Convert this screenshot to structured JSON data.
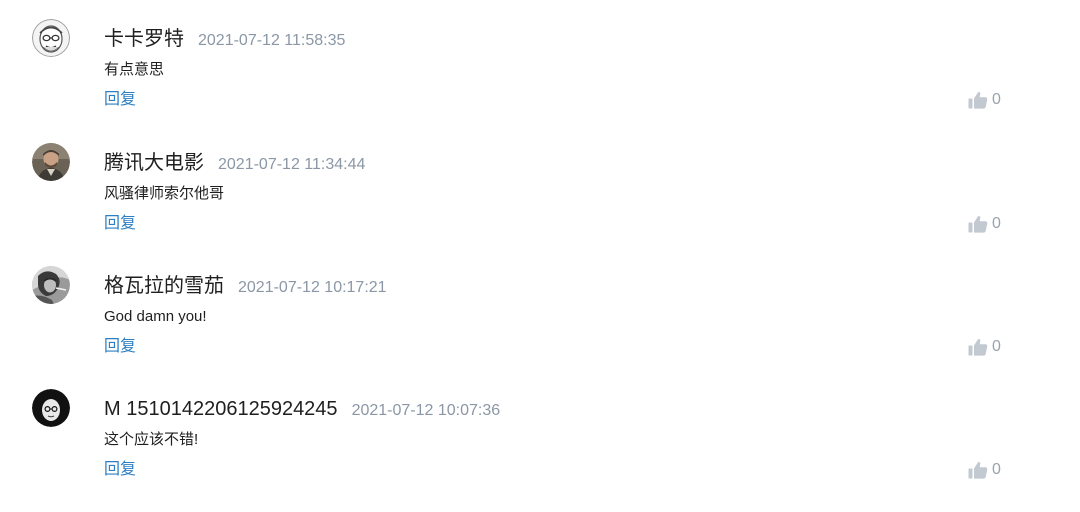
{
  "comments": [
    {
      "username": "卡卡罗特",
      "time": "2021-07-12 11:58:35",
      "content": "有点意思",
      "reply_label": "回复",
      "like_count": "0",
      "avatar_icon": "cartoon-face-avatar"
    },
    {
      "username": "腾讯大电影",
      "time": "2021-07-12 11:34:44",
      "content": "风骚律师索尔他哥",
      "reply_label": "回复",
      "like_count": "0",
      "avatar_icon": "photo-avatar"
    },
    {
      "username": "格瓦拉的雪茄",
      "time": "2021-07-12 10:17:21",
      "content": "God damn you!",
      "reply_label": "回复",
      "like_count": "0",
      "avatar_icon": "grayscale-photo-avatar"
    },
    {
      "username": "M 1510142206125924245",
      "time": "2021-07-12 10:07:36",
      "content": "这个应该不错!",
      "reply_label": "回复",
      "like_count": "0",
      "avatar_icon": "dark-face-avatar"
    }
  ],
  "colors": {
    "reply_link": "#2d7fc4",
    "timestamp": "#8b97a6",
    "like_icon": "#c3c9d0"
  }
}
